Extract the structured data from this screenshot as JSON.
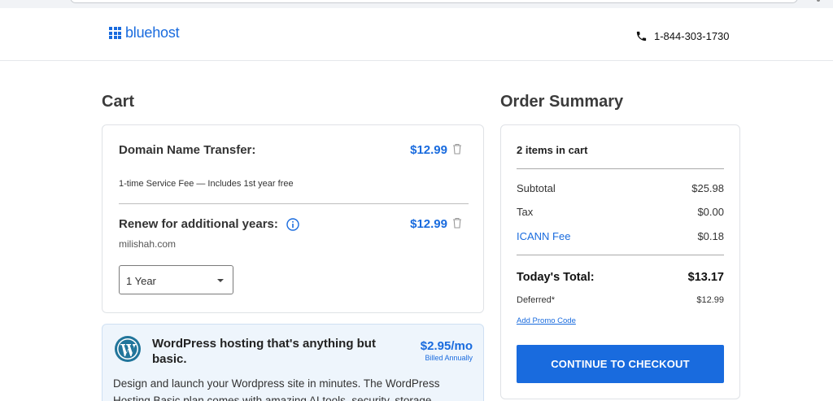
{
  "brand": {
    "name": "bluehost",
    "color": "#196bde"
  },
  "header": {
    "phone": "1-844-303-1730",
    "phone_icon": "phone-icon"
  },
  "cart": {
    "title": "Cart",
    "items": [
      {
        "name": "Domain Name Transfer:",
        "price": "$12.99",
        "note": "1-time Service Fee — Includes 1st year free"
      },
      {
        "name": "Renew for additional years:",
        "price": "$12.99",
        "domain": "milishah.com",
        "term_selected": "1 Year"
      }
    ]
  },
  "promo_card": {
    "title": "WordPress hosting that's anything but basic.",
    "price": "$2.95/mo",
    "billing": "Billed Annually",
    "description": "Design and launch your Wordpress site in minutes.  The WordPress Hosting Basic plan comes with amazing AI tools, security, storage"
  },
  "summary": {
    "title": "Order Summary",
    "items_count": "2 items in cart",
    "rows": [
      {
        "label": "Subtotal",
        "value": "$25.98"
      },
      {
        "label": "Tax",
        "value": "$0.00"
      },
      {
        "label": "ICANN Fee",
        "value": "$0.18"
      }
    ],
    "total_label": "Today's Total:",
    "total_value": "$13.17",
    "deferred_label": "Deferred*",
    "deferred_value": "$12.99",
    "promo_link": "Add Promo Code",
    "checkout_label": "CONTINUE TO CHECKOUT"
  }
}
